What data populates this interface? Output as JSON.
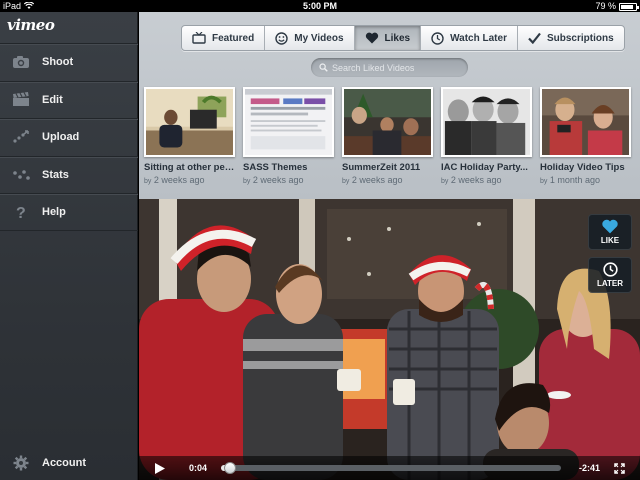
{
  "status": {
    "device": "iPad",
    "time": "5:00 PM",
    "battery": "79 %"
  },
  "sidebar": {
    "logo": "vimeo",
    "items": [
      {
        "label": "Shoot",
        "icon": "camera-icon"
      },
      {
        "label": "Edit",
        "icon": "clapperboard-icon"
      },
      {
        "label": "Upload",
        "icon": "upload-icon"
      },
      {
        "label": "Stats",
        "icon": "stats-icon"
      },
      {
        "label": "Help",
        "icon": "help-icon"
      }
    ],
    "account": {
      "label": "Account",
      "icon": "gear-icon"
    }
  },
  "tabs": [
    {
      "label": "Featured",
      "icon": "tv-icon",
      "active": false
    },
    {
      "label": "My Videos",
      "icon": "smiley-icon",
      "active": false
    },
    {
      "label": "Likes",
      "icon": "heart-icon",
      "active": true
    },
    {
      "label": "Watch Later",
      "icon": "clock-icon",
      "active": false
    },
    {
      "label": "Subscriptions",
      "icon": "checkmark-icon",
      "active": false
    }
  ],
  "search": {
    "placeholder": "Search Liked Videos"
  },
  "videos": [
    {
      "title": "Sitting at other peo...",
      "by": "by",
      "age": "2 weeks ago"
    },
    {
      "title": "SASS Themes",
      "by": "by",
      "age": "2 weeks ago"
    },
    {
      "title": "SummerZeit 2011",
      "by": "by",
      "age": "2 weeks ago"
    },
    {
      "title": "IAC Holiday Party...",
      "by": "by",
      "age": "2 weeks ago"
    },
    {
      "title": "Holiday Video Tips",
      "by": "by",
      "age": "1 month ago"
    }
  ],
  "player": {
    "like_label": "LIKE",
    "later_label": "LATER",
    "current_time": "0:04",
    "remaining_time": "-2:41",
    "progress": 0.025
  },
  "colors": {
    "accent_blue": "#39a9e0",
    "sidebar_bg": "#33383d",
    "main_bg": "#c3c8cd"
  }
}
